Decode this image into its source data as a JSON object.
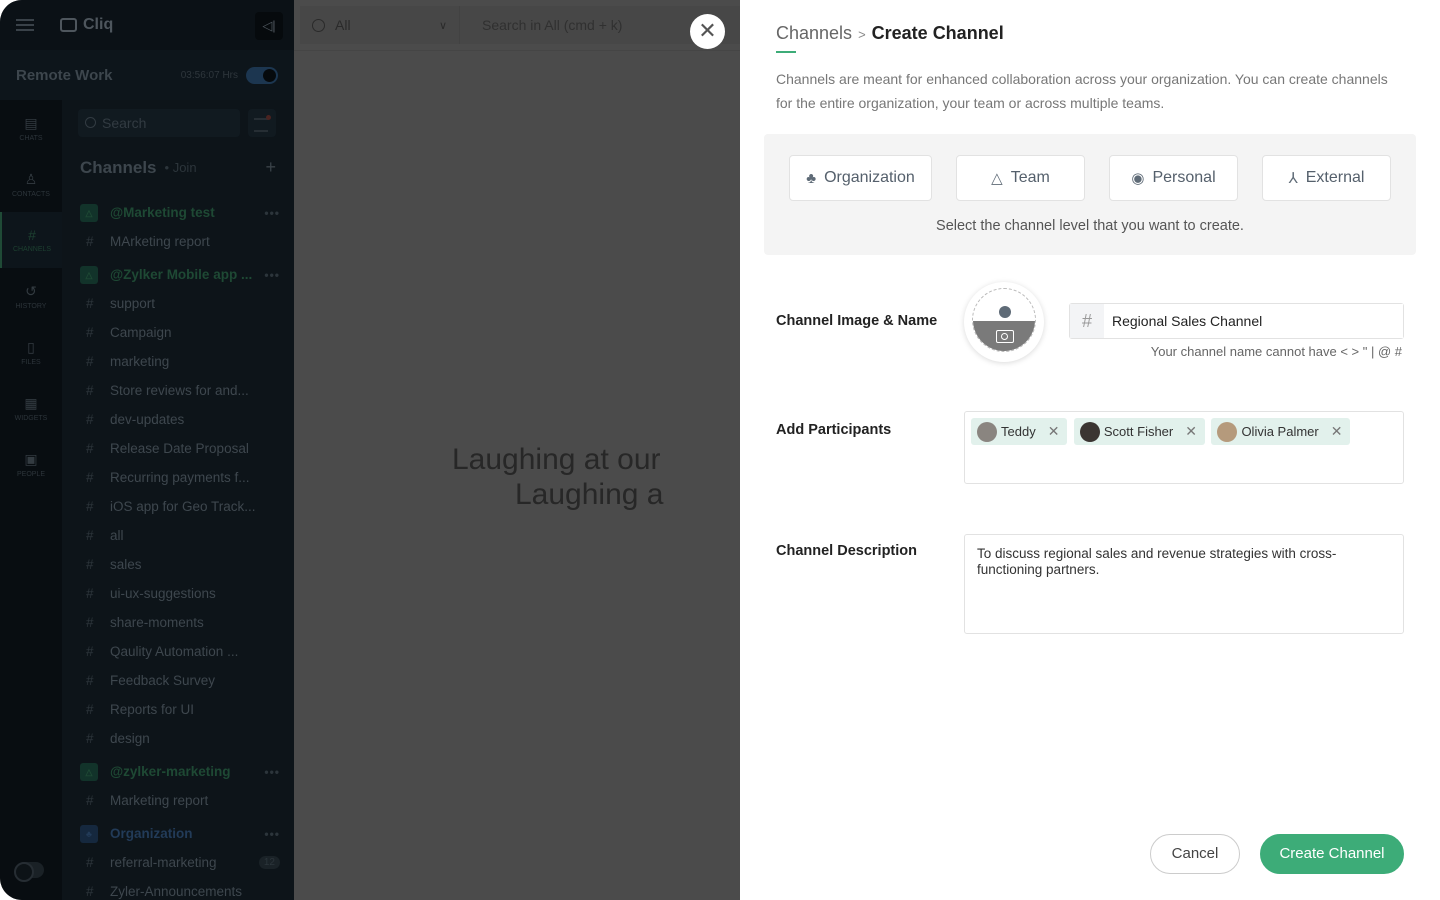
{
  "app": {
    "name": "Cliq",
    "workspace": "Remote Work",
    "timer": "03:56:07 Hrs"
  },
  "rail": [
    {
      "label": "CHATS",
      "icon": "chat-icon"
    },
    {
      "label": "CONTACTS",
      "icon": "contact-icon"
    },
    {
      "label": "CHANNELS",
      "icon": "hash-icon",
      "active": true
    },
    {
      "label": "HISTORY",
      "icon": "history-icon"
    },
    {
      "label": "FILES",
      "icon": "file-icon"
    },
    {
      "label": "WIDGETS",
      "icon": "widgets-icon"
    },
    {
      "label": "PEOPLE",
      "icon": "people-icon"
    }
  ],
  "sidebar": {
    "search_placeholder": "Search",
    "channels_title": "Channels",
    "join_label": "• Join",
    "items": [
      {
        "type": "group",
        "label": "@Marketing test"
      },
      {
        "type": "channel",
        "label": "MArketing report"
      },
      {
        "type": "group",
        "label": "@Zylker Mobile app ..."
      },
      {
        "type": "channel",
        "label": "support"
      },
      {
        "type": "channel",
        "label": "Campaign"
      },
      {
        "type": "channel",
        "label": "marketing"
      },
      {
        "type": "channel",
        "label": "Store reviews for and..."
      },
      {
        "type": "channel",
        "label": "dev-updates"
      },
      {
        "type": "channel",
        "label": "Release Date Proposal"
      },
      {
        "type": "channel",
        "label": "Recurring payments f..."
      },
      {
        "type": "channel",
        "label": "iOS app for Geo Track..."
      },
      {
        "type": "channel",
        "label": "all"
      },
      {
        "type": "channel",
        "label": "sales"
      },
      {
        "type": "channel",
        "label": "ui-ux-suggestions"
      },
      {
        "type": "channel",
        "label": "share-moments"
      },
      {
        "type": "channel",
        "label": "Qaulity Automation ..."
      },
      {
        "type": "channel",
        "label": "Feedback Survey"
      },
      {
        "type": "channel",
        "label": "Reports for UI"
      },
      {
        "type": "channel",
        "label": "design"
      },
      {
        "type": "group",
        "label": "@zylker-marketing"
      },
      {
        "type": "channel",
        "label": "Marketing report"
      },
      {
        "type": "org",
        "label": "Organization"
      },
      {
        "type": "channel",
        "label": "referral-marketing",
        "badge": "12"
      },
      {
        "type": "channel",
        "label": "Zyler-Announcements"
      }
    ]
  },
  "global_search": {
    "scope": "All",
    "placeholder": "Search in All (cmd + k)"
  },
  "background_text": {
    "line1": "Laughing at our",
    "line2": "Laughing a"
  },
  "modal": {
    "breadcrumb_parent": "Channels",
    "breadcrumb_sep": ">",
    "title": "Create Channel",
    "intro": "Channels are meant for enhanced collaboration across your organization. You can create channels for the entire organization, your team or across multiple teams.",
    "levels": [
      {
        "label": "Organization",
        "icon": "org-icon"
      },
      {
        "label": "Team",
        "icon": "team-icon"
      },
      {
        "label": "Personal",
        "icon": "personal-icon"
      },
      {
        "label": "External",
        "icon": "external-icon"
      }
    ],
    "levels_hint": "Select the channel level that you want to create.",
    "image_name_label": "Channel Image & Name",
    "name_value": "Regional Sales Channel",
    "name_hint": "Your channel name cannot have < > \" | @ #",
    "participants_label": "Add Participants",
    "participants": [
      "Teddy",
      "Scott Fisher",
      "Olivia Palmer"
    ],
    "description_label": "Channel Description",
    "description_value": "To discuss regional sales and revenue strategies with cross-functioning partners.",
    "cancel": "Cancel",
    "create": "Create Channel"
  },
  "colors": {
    "accent": "#3dac78",
    "chip_bg": "#e2f1ec"
  }
}
